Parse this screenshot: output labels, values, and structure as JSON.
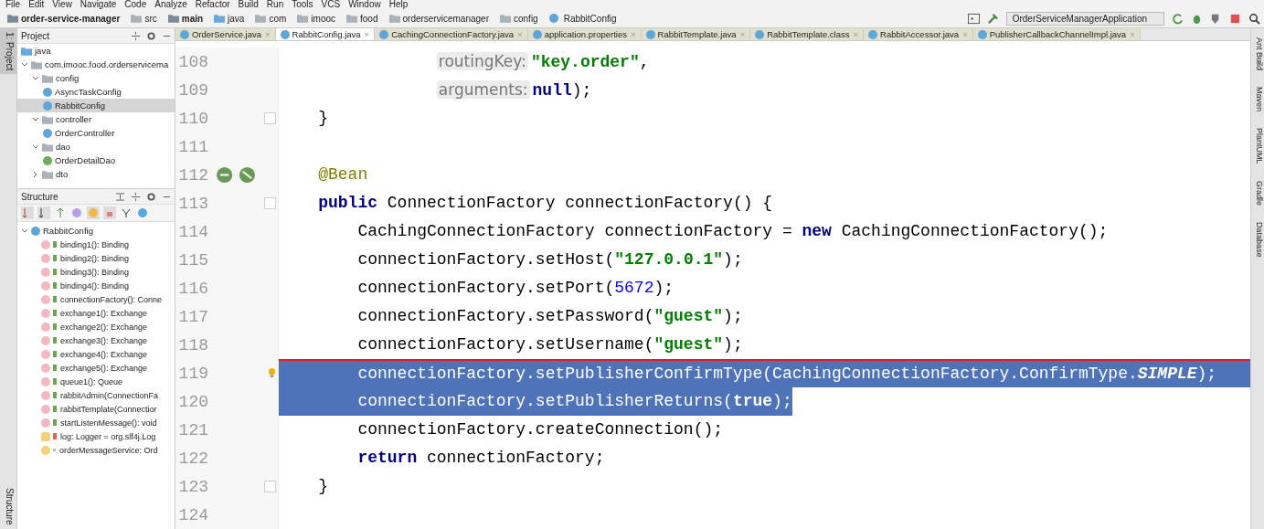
{
  "menu": [
    "File",
    "Edit",
    "View",
    "Navigate",
    "Code",
    "Analyze",
    "Refactor",
    "Build",
    "Run",
    "Tools",
    "VCS",
    "Window",
    "Help"
  ],
  "breadcrumbs": [
    {
      "text": "order-service-manager",
      "kind": "project"
    },
    {
      "text": "src",
      "kind": "folder"
    },
    {
      "text": "main",
      "kind": "project"
    },
    {
      "text": "java",
      "kind": "source"
    },
    {
      "text": "com",
      "kind": "folder"
    },
    {
      "text": "imooc",
      "kind": "folder"
    },
    {
      "text": "food",
      "kind": "folder"
    },
    {
      "text": "orderservicemanager",
      "kind": "folder"
    },
    {
      "text": "config",
      "kind": "folder"
    },
    {
      "text": "RabbitConfig",
      "kind": "class"
    }
  ],
  "run_config": "OrderServiceManagerApplication",
  "left_strip": {
    "top": "1: Project",
    "bottom": "Structure"
  },
  "project_panel": {
    "title": "Project",
    "tree": [
      {
        "label": "java",
        "kind": "source",
        "selected": false,
        "children": [
          {
            "label": "com.imooc.food.orderservicema",
            "kind": "folder",
            "selected": false,
            "expanded": true,
            "children": [
              {
                "label": "config",
                "kind": "folder",
                "selected": false,
                "expanded": true,
                "children": [
                  {
                    "label": "AsyncTaskConfig",
                    "kind": "class",
                    "selected": false
                  },
                  {
                    "label": "RabbitConfig",
                    "kind": "class",
                    "selected": true
                  }
                ]
              },
              {
                "label": "controller",
                "kind": "folder",
                "selected": false,
                "expanded": true,
                "children": [
                  {
                    "label": "OrderController",
                    "kind": "class",
                    "selected": false
                  }
                ]
              },
              {
                "label": "dao",
                "kind": "folder",
                "selected": false,
                "expanded": true,
                "children": [
                  {
                    "label": "OrderDetailDao",
                    "kind": "interface",
                    "selected": false
                  }
                ]
              },
              {
                "label": "dto",
                "kind": "folder",
                "selected": false,
                "expanded": false
              }
            ]
          }
        ]
      }
    ]
  },
  "structure_panel": {
    "title": "Structure",
    "root": "RabbitConfig",
    "expanded": true,
    "items": [
      {
        "label": "binding1(): Binding",
        "kind": "public_method"
      },
      {
        "label": "binding2(): Binding",
        "kind": "public_method"
      },
      {
        "label": "binding3(): Binding",
        "kind": "public_method"
      },
      {
        "label": "binding4(): Binding",
        "kind": "public_method"
      },
      {
        "label": "connectionFactory(): Conne",
        "kind": "public_method"
      },
      {
        "label": "exchange1(): Exchange",
        "kind": "public_method"
      },
      {
        "label": "exchange2(): Exchange",
        "kind": "public_method"
      },
      {
        "label": "exchange3(): Exchange",
        "kind": "public_method"
      },
      {
        "label": "exchange4(): Exchange",
        "kind": "public_method"
      },
      {
        "label": "exchange5(): Exchange",
        "kind": "public_method"
      },
      {
        "label": "queue1(): Queue",
        "kind": "public_method"
      },
      {
        "label": "rabbitAdmin(ConnectionFa",
        "kind": "public_method"
      },
      {
        "label": "rabbitTemplate(Connectior",
        "kind": "public_method"
      },
      {
        "label": "startListenMessage(): void",
        "kind": "public_method"
      },
      {
        "label": "log: Logger = org.slf4j.Log",
        "kind": "private_static_field"
      },
      {
        "label": "orderMessageService: Ord",
        "kind": "package_field"
      }
    ]
  },
  "tabs": [
    {
      "label": "OrderService.java",
      "selected": false,
      "close": "×"
    },
    {
      "label": "RabbitConfig.java",
      "selected": true,
      "close": "×"
    },
    {
      "label": "CachingConnectionFactory.java",
      "selected": false,
      "close": "×"
    },
    {
      "label": "application.properties",
      "selected": false,
      "close": "×"
    },
    {
      "label": "RabbitTemplate.java",
      "selected": false,
      "close": "×"
    },
    {
      "label": "RabbitTemplate.class",
      "selected": false,
      "close": "×"
    },
    {
      "label": "RabbitAccessor.java",
      "selected": false,
      "close": "×"
    },
    {
      "label": "PublisherCallbackChannelImpl.java",
      "selected": false,
      "close": "×"
    }
  ],
  "code": [
    {
      "number": "108",
      "kind": "continuation",
      "selected": false,
      "segments": [
        {
          "kind": "hint",
          "text": "routingKey:"
        },
        {
          "kind": "string",
          "text": "\"key.order\""
        },
        {
          "kind": "plain",
          "text": ","
        }
      ]
    },
    {
      "number": "109",
      "kind": "continuation",
      "selected": false,
      "segments": [
        {
          "kind": "hint",
          "text": "arguments:"
        },
        {
          "kind": "keyword",
          "text": "null"
        },
        {
          "kind": "plain",
          "text": ");"
        }
      ]
    },
    {
      "number": "110",
      "kind": "member",
      "selected": false,
      "gutter": {
        "kind": "fold"
      },
      "segments": [
        {
          "kind": "plain",
          "text": "}"
        }
      ]
    },
    {
      "number": "111",
      "kind": "blank",
      "selected": false
    },
    {
      "number": "112",
      "kind": "member",
      "selected": false,
      "gutter": {
        "kind": "bean"
      },
      "segments": [
        {
          "kind": "annotation",
          "text": "@Bean"
        }
      ]
    },
    {
      "number": "113",
      "kind": "member",
      "selected": false,
      "gutter": {
        "kind": "fold"
      },
      "segments": [
        {
          "kind": "keyword",
          "text": "public"
        },
        {
          "kind": "plain",
          "text": " ConnectionFactory connectionFactory() {"
        }
      ]
    },
    {
      "number": "114",
      "kind": "body",
      "selected": false,
      "segments": [
        {
          "kind": "plain",
          "text": "CachingConnectionFactory connectionFactory = "
        },
        {
          "kind": "keyword",
          "text": "new"
        },
        {
          "kind": "plain",
          "text": " CachingConnectionFactory();"
        }
      ]
    },
    {
      "number": "115",
      "kind": "body",
      "selected": false,
      "segments": [
        {
          "kind": "plain",
          "text": "connectionFactory.setHost("
        },
        {
          "kind": "string",
          "text": "\"127.0.0.1\""
        },
        {
          "kind": "plain",
          "text": ");"
        }
      ]
    },
    {
      "number": "116",
      "kind": "body",
      "selected": false,
      "segments": [
        {
          "kind": "plain",
          "text": "connectionFactory.setPort("
        },
        {
          "kind": "number",
          "text": "5672"
        },
        {
          "kind": "plain",
          "text": ");"
        }
      ]
    },
    {
      "number": "117",
      "kind": "body",
      "selected": false,
      "segments": [
        {
          "kind": "plain",
          "text": "connectionFactory.setPassword("
        },
        {
          "kind": "string",
          "text": "\"guest\""
        },
        {
          "kind": "plain",
          "text": ");"
        }
      ]
    },
    {
      "number": "118",
      "kind": "body",
      "selected": false,
      "segments": [
        {
          "kind": "plain",
          "text": "connectionFactory.setUsername("
        },
        {
          "kind": "string",
          "text": "\"guest\""
        },
        {
          "kind": "plain",
          "text": ");"
        }
      ]
    },
    {
      "number": "119",
      "kind": "body",
      "selected": true,
      "gutter": {
        "kind": "bulb"
      },
      "segments": [
        {
          "kind": "plain",
          "text": "connectionFactory.setPublisherConfirmType(CachingConnectionFactory.ConfirmType."
        },
        {
          "kind": "static",
          "text": "SIMPLE"
        },
        {
          "kind": "plain",
          "text": ");"
        }
      ]
    },
    {
      "number": "120",
      "kind": "body",
      "selected": true,
      "segments": [
        {
          "kind": "plain",
          "text": "connectionFactory.setPublisherReturns("
        },
        {
          "kind": "keyword",
          "text": "true"
        },
        {
          "kind": "plain",
          "text": ");"
        }
      ]
    },
    {
      "number": "121",
      "kind": "body",
      "selected": false,
      "segments": [
        {
          "kind": "plain",
          "text": "connectionFactory.createConnection();"
        }
      ]
    },
    {
      "number": "122",
      "kind": "body",
      "selected": false,
      "segments": [
        {
          "kind": "keyword",
          "text": "return"
        },
        {
          "kind": "plain",
          "text": " connectionFactory;"
        }
      ]
    },
    {
      "number": "123",
      "kind": "member",
      "selected": false,
      "gutter": {
        "kind": "fold"
      },
      "segments": [
        {
          "kind": "plain",
          "text": "}"
        }
      ]
    },
    {
      "number": "124",
      "kind": "blank",
      "selected": false
    }
  ],
  "right_strip": [
    "Ant Build",
    "Maven",
    "PlantUML",
    "Gradle",
    "Database"
  ]
}
